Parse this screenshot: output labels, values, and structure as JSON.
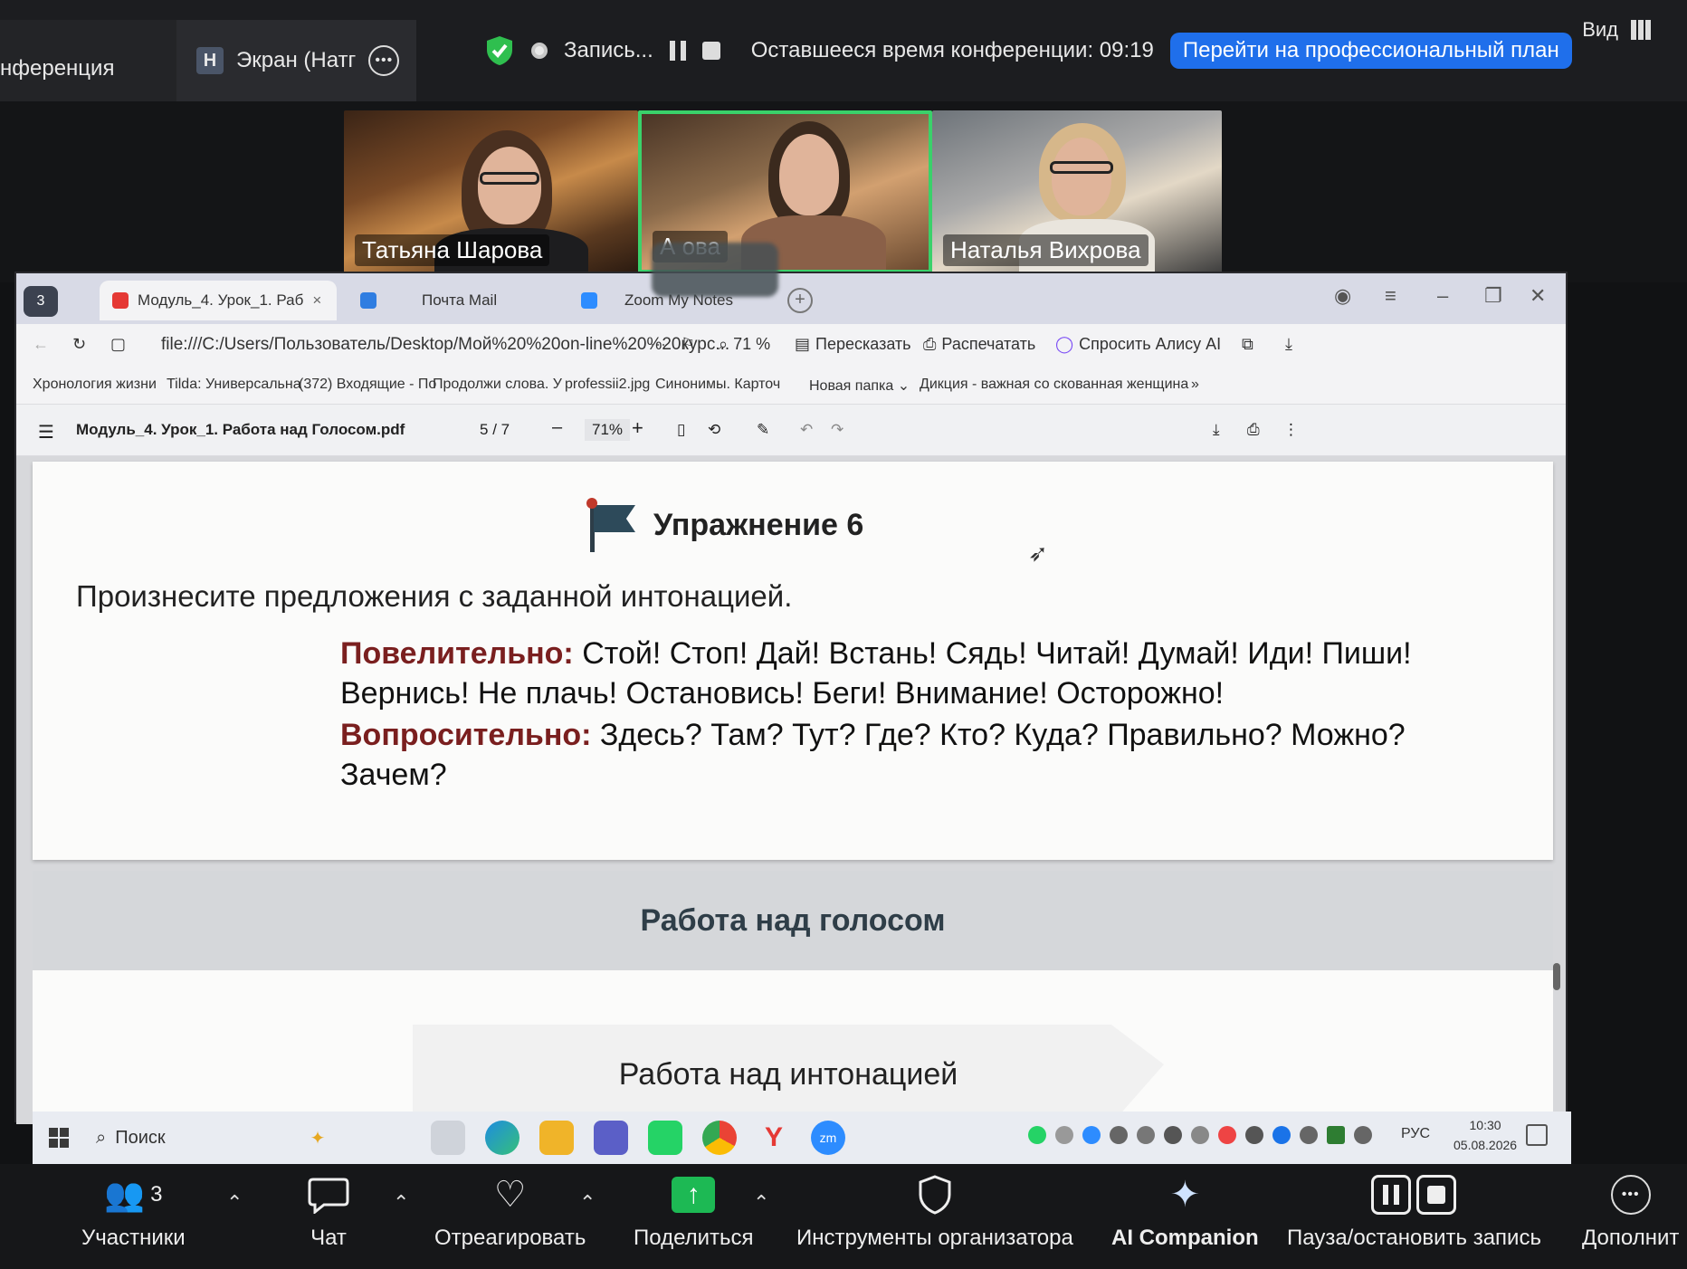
{
  "zoom_top": {
    "conference_tab": "нференция",
    "screen_badge": "Н",
    "screen_tab": "Экран (Натг",
    "recording_label": "Запись...",
    "time_left": "Оставшееся время конференции: 09:19",
    "upgrade": "Перейти на профессиональный план",
    "view": "Вид"
  },
  "participants": [
    {
      "name": "Татьяна Шарова"
    },
    {
      "name": "А              ова"
    },
    {
      "name": "Наталья Вихрова"
    }
  ],
  "browser": {
    "tabs": [
      {
        "label": "Модуль_4. Урок_1. Раб",
        "close": "×"
      },
      {
        "label": "Почта Mail"
      },
      {
        "label": "Zoom My Notes"
      }
    ],
    "new_tab": "+",
    "url": "file:///C:/Users/Пользователь/Desktop/Мой%20%20on-line%20%20курс...",
    "more": "···",
    "zoom": "71 %",
    "retell": "Пересказать",
    "print": "Распечатать",
    "ask_alice": "Спросить Алису AI",
    "bookmarks": [
      "Хронология жизни",
      "Tilda: Универсальна",
      "(372) Входящие - По",
      "Продолжи слова. У",
      "professii2.jpg",
      "Синонимы. Карточ",
      "Новая папка",
      "Дикция - важная со",
      "скованная женщина",
      "»"
    ]
  },
  "pdf": {
    "filename": "Модуль_4. Урок_1. Работа над Голосом.pdf",
    "page_current": "5",
    "page_sep": "/",
    "page_total": "7",
    "zoom": "71%",
    "minus": "–",
    "plus": "+",
    "exercise_title": "Упражнение 6",
    "instruction": "Произнесите предложения с заданной интонацией.",
    "imperative_label": "Повелительно:",
    "imperative_text": " Стой! Стоп! Дай! Встань! Сядь! Читай! Думай! Иди! Пиши! Вернись! Не плачь! Остановись! Беги! Внимание! Осторожно!",
    "question_label": "Вопросительно:",
    "question_text": " Здесь? Там? Тут? Где? Кто? Куда? Правильно? Можно? Зачем?",
    "next_header": "Работа над голосом",
    "next_subheader": "Работа над интонацией"
  },
  "taskbar": {
    "search": "Поиск",
    "lang": "РУС",
    "time": "10:30",
    "date": "05.08.2026"
  },
  "zoom_bottom": {
    "participants_label": "Участники",
    "participants_count": "3",
    "chat": "Чат",
    "react": "Отреагировать",
    "share": "Поделиться",
    "host_tools": "Инструменты организатора",
    "ai": "AI Companion",
    "pause_stop": "Пауза/остановить запись",
    "more": "Дополнит"
  },
  "colors": {
    "zoom_bg": "#1c1d20",
    "upgrade_blue": "#1f6feb",
    "speaker_border": "#3ad16a",
    "label_red": "#7a1f1f"
  }
}
